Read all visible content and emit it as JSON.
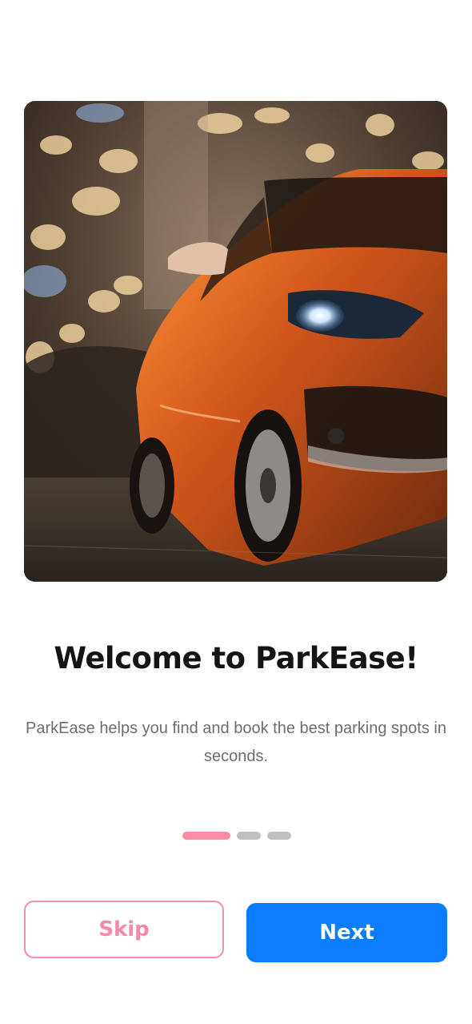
{
  "onboarding": {
    "title": "Welcome to ParkEase!",
    "subtitle": "ParkEase helps you find and book the best parking spots in seconds.",
    "pagination": {
      "total": 3,
      "active_index": 0
    },
    "buttons": {
      "skip_label": "Skip",
      "next_label": "Next"
    }
  },
  "colors": {
    "primary": "#0a7cff",
    "accent_pink": "#f58aa6",
    "title_text": "#141414",
    "body_text": "#6d6d6d",
    "dot_inactive": "#c0c0c0"
  }
}
